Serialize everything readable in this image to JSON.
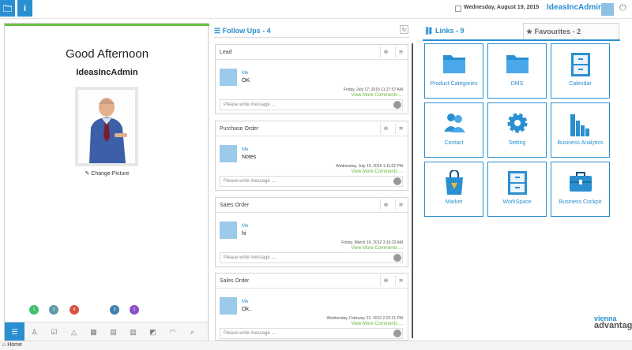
{
  "header": {
    "date": "Wednesday, August 19, 2015",
    "user": "IdeasIncAdmin",
    "btn_left_icon": "folder-icon",
    "btn_info_label": "i"
  },
  "profile": {
    "greeting": "Good Afternoon",
    "name": "IdeasIncAdmin",
    "change_picture": "Change Picture",
    "badges": [
      "1",
      "3",
      "4",
      "3",
      "1"
    ],
    "badge_colors": [
      "#3fbf6b",
      "#5b9aa8",
      "#d9533f",
      "#3f7fb0",
      "#8b4fc8"
    ]
  },
  "followups": {
    "title": "Follow Ups - 4",
    "placeholder": "Please write message ....",
    "more": "View More Comments ...",
    "cards": [
      {
        "title": "Lead",
        "who": "Me",
        "msg": "OK",
        "date": "Friday, July 17, 2015 11:27:57 AM"
      },
      {
        "title": "Purchase Order",
        "who": "Me",
        "msg": "Notes",
        "date": "Wednesday, July 15, 2015 1:11:02 PM"
      },
      {
        "title": "Sales Order",
        "who": "Me",
        "msg": "hi",
        "date": "Friday, March 16, 2012 3:16:22 AM"
      },
      {
        "title": "Sales Order",
        "who": "Me",
        "msg": "Ok..",
        "date": "Wednesday, February 22, 2012 2:22:21 PM"
      }
    ]
  },
  "links": {
    "title": "Links - 9",
    "favourites": "Favourites - 2",
    "tiles": [
      {
        "label": "Product Categories",
        "icon": "folder-icon"
      },
      {
        "label": "DMS",
        "icon": "folder-icon"
      },
      {
        "label": "Calendar",
        "icon": "cabinet-icon"
      },
      {
        "label": "Contact",
        "icon": "contacts-icon"
      },
      {
        "label": "Setting",
        "icon": "gear-icon"
      },
      {
        "label": "Business Analytics",
        "icon": "bar-chart-icon"
      },
      {
        "label": "Market",
        "icon": "shopping-bag-icon"
      },
      {
        "label": "WorkSpace",
        "icon": "cabinet-icon"
      },
      {
        "label": "Business Cockpit",
        "icon": "briefcase-icon"
      }
    ]
  },
  "footer": {
    "home": "Home",
    "brand_top": "vienna",
    "brand_bottom": "advantage"
  }
}
